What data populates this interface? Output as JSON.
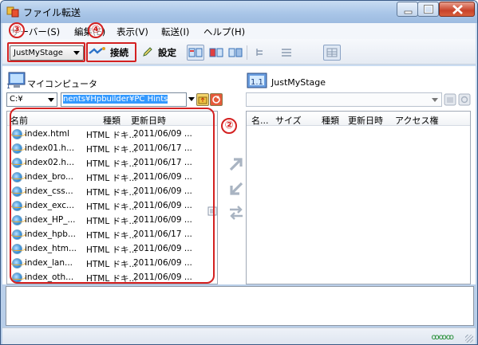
{
  "window": {
    "title": "ファイル転送"
  },
  "menu": [
    {
      "label": "サーバー(S)"
    },
    {
      "label": "編集(E)"
    },
    {
      "label": "表示(V)"
    },
    {
      "label": "転送(I)"
    },
    {
      "label": "ヘルプ(H)"
    }
  ],
  "toolbar": {
    "connection_select": "JustMyStage",
    "connect_label": "接続",
    "settings_label": "設定"
  },
  "callouts": {
    "c2": "②",
    "c3": "③",
    "c4": "④"
  },
  "local": {
    "label": "マイコンピュータ",
    "drive": "C:¥",
    "path": "nents¥Hpbuilder¥PC Hints",
    "columns": {
      "name": "名前",
      "type": "種類",
      "date": "更新日時"
    },
    "files": [
      {
        "name": "index.html",
        "type": "HTML ドキ...",
        "date": "2011/06/09 ..."
      },
      {
        "name": "index01.h...",
        "type": "HTML ドキ...",
        "date": "2011/06/17 ..."
      },
      {
        "name": "index02.h...",
        "type": "HTML ドキ...",
        "date": "2011/06/17 ..."
      },
      {
        "name": "index_bro...",
        "type": "HTML ドキ...",
        "date": "2011/06/09 ..."
      },
      {
        "name": "index_css...",
        "type": "HTML ドキ...",
        "date": "2011/06/09 ..."
      },
      {
        "name": "index_exc...",
        "type": "HTML ドキ...",
        "date": "2011/06/09 ..."
      },
      {
        "name": "index_HP_...",
        "type": "HTML ドキ...",
        "date": "2011/06/09 ..."
      },
      {
        "name": "index_hpb...",
        "type": "HTML ドキ...",
        "date": "2011/06/17 ..."
      },
      {
        "name": "index_htm...",
        "type": "HTML ドキ...",
        "date": "2011/06/09 ..."
      },
      {
        "name": "index_lan...",
        "type": "HTML ドキ...",
        "date": "2011/06/09 ..."
      },
      {
        "name": "index_oth...",
        "type": "HTML ドキ...",
        "date": "2011/06/09 ..."
      }
    ]
  },
  "remote": {
    "label": "JustMyStage",
    "columns": {
      "name": "名...",
      "size": "サイズ",
      "type": "種類",
      "date": "更新日時",
      "access": "アクセス権"
    }
  },
  "status": {
    "indicator": "ꝏꝏꝏ"
  },
  "colors": {
    "highlight_red": "#d42121",
    "selection_blue": "#3399ff"
  }
}
